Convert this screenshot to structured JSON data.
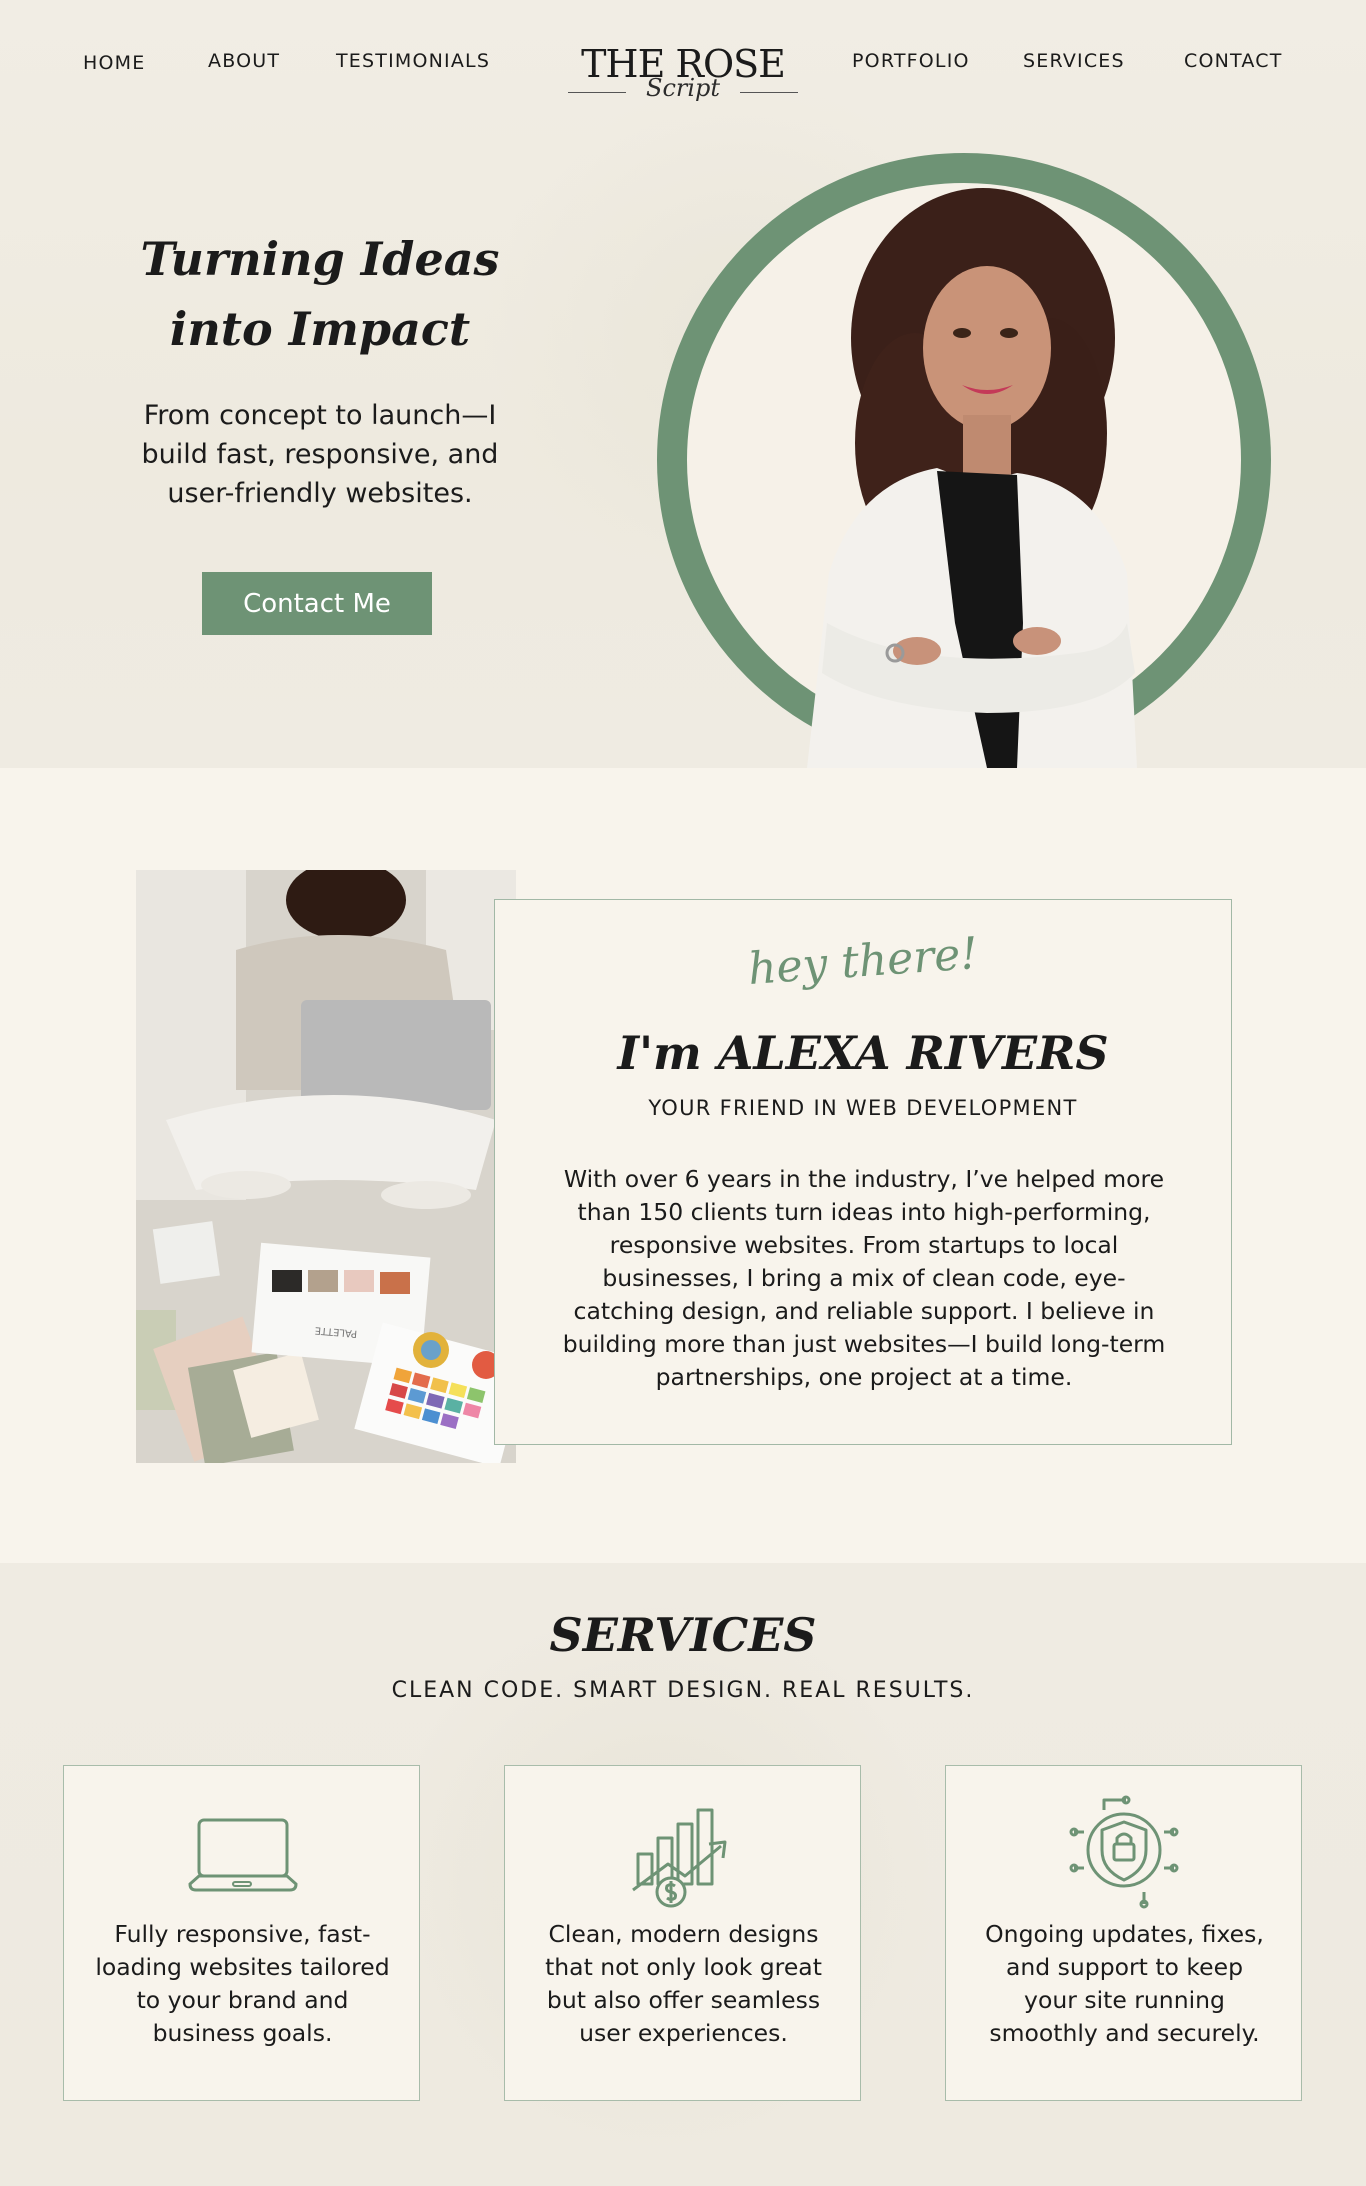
{
  "nav": {
    "left": [
      "HOME",
      "ABOUT",
      "TESTIMONIALS"
    ],
    "right": [
      "PORTFOLIO",
      "SERVICES",
      "CONTACT"
    ]
  },
  "logo": {
    "main": "THE ROSE",
    "script": "Script"
  },
  "hero": {
    "title_line1": "Turning Ideas",
    "title_line2": "into Impact",
    "subtitle": "From concept to launch—I build fast, responsive, and user-friendly websites.",
    "cta_label": "Contact Me"
  },
  "about": {
    "greeting": "hey there!",
    "name": "I'm ALEXA RIVERS",
    "tagline": "YOUR FRIEND IN WEB DEVELOPMENT",
    "body": "With over 6 years in the industry, I’ve helped more than 150 clients turn ideas into high-performing, responsive websites. From startups to local businesses, I bring a mix of clean code, eye-catching design, and reliable support. I believe in building more than just websites—I build long-term partnerships, one project at a time.",
    "palette_label": "PALETTE"
  },
  "services": {
    "title": "SERVICES",
    "subtitle": "CLEAN CODE. SMART DESIGN. REAL RESULTS.",
    "items": [
      {
        "icon": "laptop-icon",
        "text": "Fully responsive, fast-loading websites tailored to your brand and business goals."
      },
      {
        "icon": "growth-chart-icon",
        "text": "Clean, modern designs that not only look great but also offer seamless user experiences."
      },
      {
        "icon": "security-shield-icon",
        "text": "Ongoing updates, fixes, and support to keep your site running smoothly and securely."
      }
    ]
  },
  "colors": {
    "accent": "#6e9375",
    "background": "#f8f4ec",
    "hero_bg": "#efebe2",
    "text": "#1b1b1b",
    "card_border": "#a8bcaa"
  }
}
